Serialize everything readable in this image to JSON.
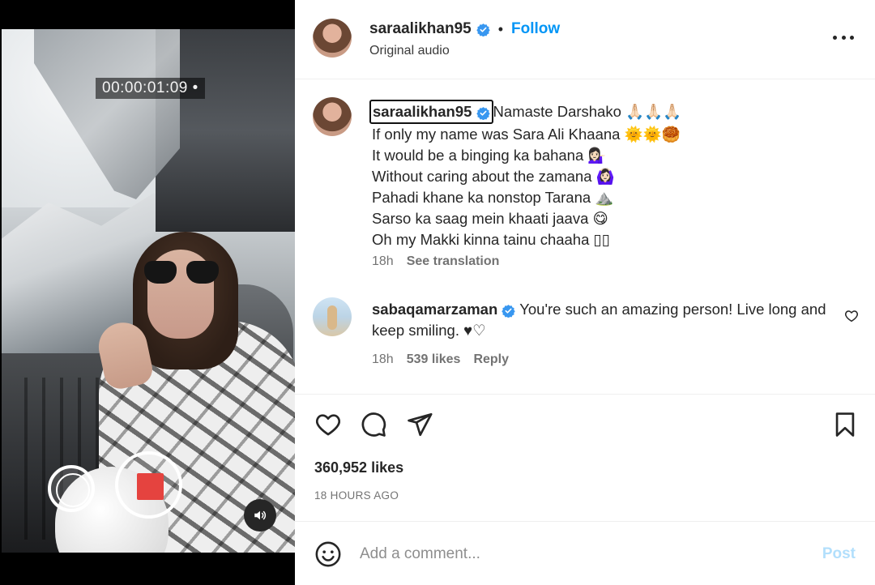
{
  "video": {
    "timer": "00:00:01:09 •"
  },
  "header": {
    "username": "saraalikhan95",
    "separator": "•",
    "follow_label": "Follow",
    "audio": "Original audio"
  },
  "caption": {
    "username": "saraalikhan95",
    "lines": [
      "Namaste Darshako 🙏🏻🙏🏻🙏🏻",
      "If only my name was Sara Ali Khaana 🌞🌞🥮",
      "It would be a binging ka bahana 💁🏻‍♀️",
      "Without caring about the zamana 🙆🏻‍♀️",
      "Pahadi khane ka nonstop Tarana ⛰️",
      "Sarso ka saag mein khaati jaava 😋",
      "Oh my Makki kinna tainu chaaha ▯▯"
    ],
    "time": "18h",
    "see_translation": "See translation"
  },
  "comment": {
    "username": "sabaqamarzaman",
    "text": "You're such an amazing person! Live long and keep smiling. ♥♡",
    "time": "18h",
    "likes": "539 likes",
    "reply": "Reply"
  },
  "post": {
    "likes": "360,952 likes",
    "time_ago": "18 HOURS AGO"
  },
  "add_comment": {
    "placeholder": "Add a comment...",
    "post_label": "Post"
  },
  "icons": {
    "like": "heart-icon",
    "comment": "comment-icon",
    "share": "paper-plane-icon",
    "save": "bookmark-icon",
    "emoji": "smiley-icon",
    "audio": "speaker-icon",
    "verified": "verified-badge-icon",
    "more": "more-options-icon"
  },
  "colors": {
    "accent": "#0095f6",
    "verified": "#3897f0",
    "record": "#e5433f",
    "post_disabled": "#b2dffc"
  }
}
